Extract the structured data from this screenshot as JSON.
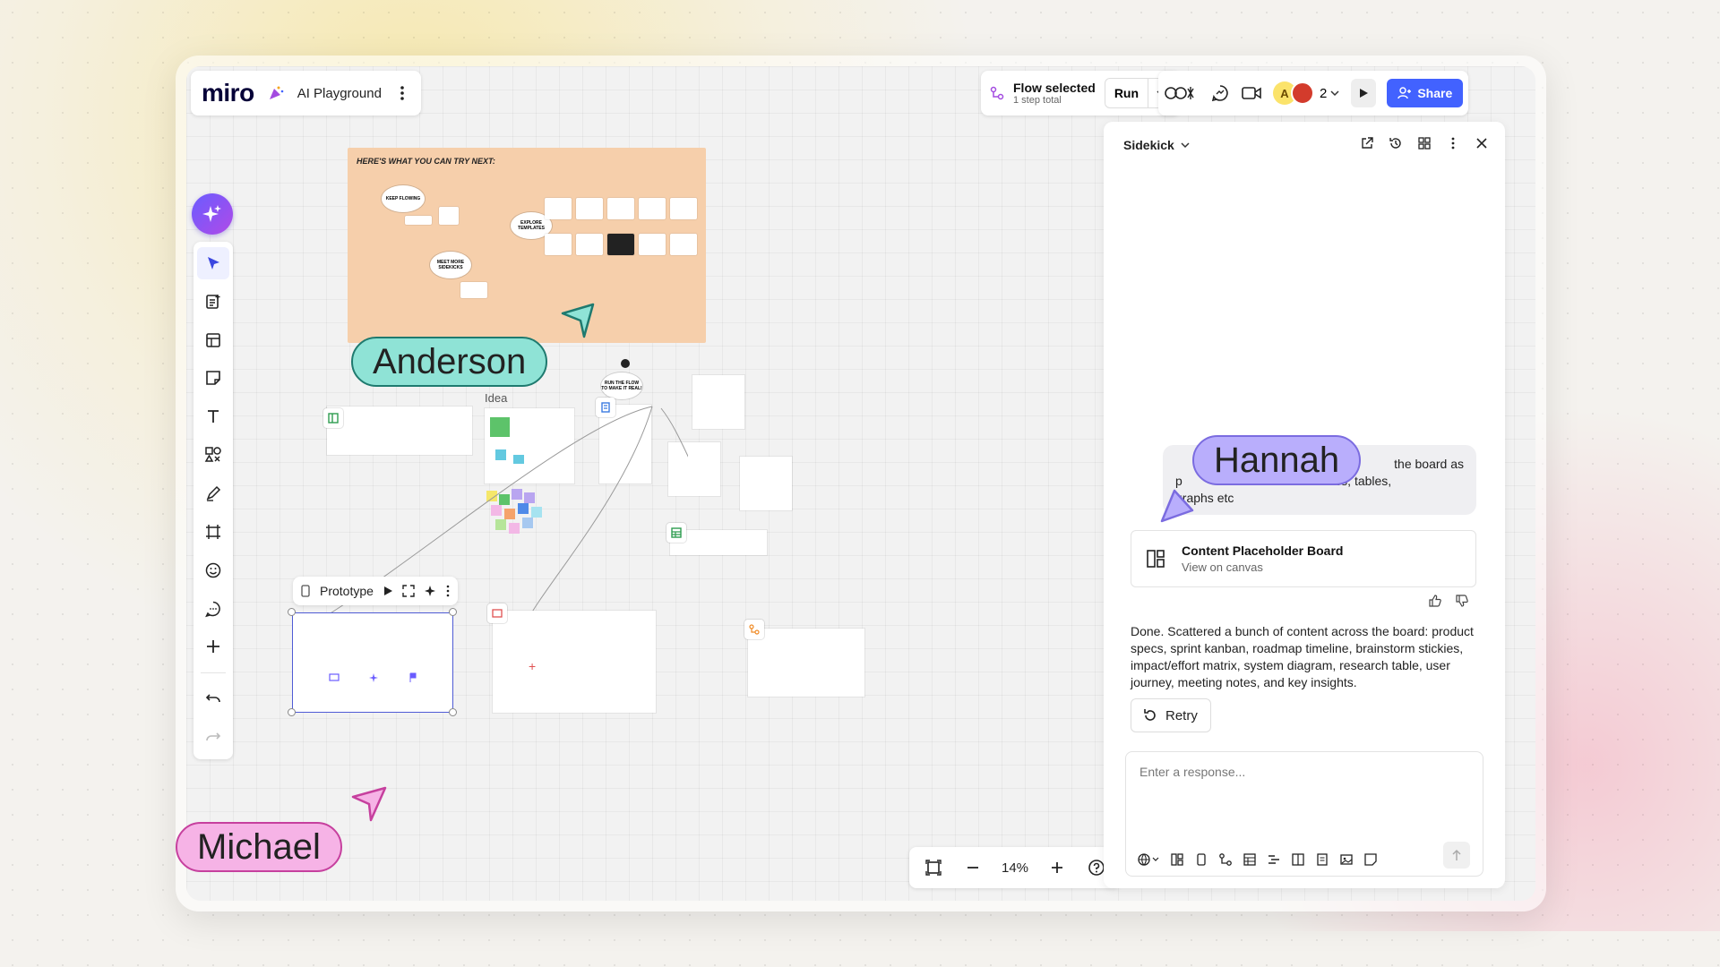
{
  "app": {
    "logo": "miro",
    "board_name": "AI Playground"
  },
  "flow": {
    "title": "Flow selected",
    "subtitle": "1 step total",
    "run_label": "Run"
  },
  "collab": {
    "avatar_letter": "A",
    "viewer_count": "2",
    "share_label": "Share"
  },
  "toolbar": {
    "tools": [
      "select-icon",
      "doc-icon",
      "table-icon",
      "sticky-note-icon",
      "text-icon",
      "shapes-icon",
      "pen-icon",
      "frame-icon",
      "emoji-icon",
      "comment-icon",
      "add-icon",
      "undo-icon",
      "redo-icon"
    ]
  },
  "zoom": {
    "value": "14%"
  },
  "canvas": {
    "frame_title": "HERE'S WHAT YOU CAN TRY NEXT:",
    "cloud_keep": "KEEP FLOWING",
    "cloud_explore": "EXPLORE TEMPLATES",
    "cloud_meet": "MEET MORE SIDEKICKS",
    "cloud_run": "RUN THE FLOW TO MAKE IT REAL!",
    "idea_label": "Idea",
    "prototype_label": "Prototype"
  },
  "sidekick": {
    "title": "Sidekick",
    "user_message": "p... the board as ... make docs, tables, graphs etc",
    "user_message_line1": "the board as",
    "user_message_line2": "p                              make docs, tables,",
    "user_message_line3": "graphs etc",
    "card_title": "Content Placeholder Board",
    "card_sub": "View on canvas",
    "reply": "Done. Scattered a bunch of content across the board: product specs, sprint kanban, roadmap timeline, brainstorm stickies, impact/effort matrix, system diagram, research table, user journey, meeting notes, and key insights.",
    "retry_label": "Retry",
    "input_placeholder": "Enter a response..."
  },
  "cursors": {
    "anderson": {
      "name": "Anderson",
      "color": "#8fe3d6",
      "border": "#2a9d8f"
    },
    "hannah": {
      "name": "Hannah",
      "color": "#b9aefc",
      "border": "#7b6ce0"
    },
    "michael": {
      "name": "Michael",
      "color": "#f6b3e6",
      "border": "#d24fb6"
    }
  },
  "colors": {
    "accent": "#4262ff",
    "frame": "#f6cfab"
  }
}
